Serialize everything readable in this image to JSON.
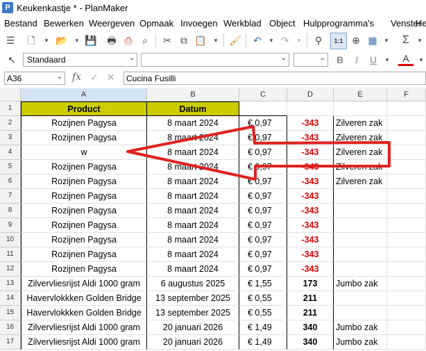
{
  "window": {
    "title": "Keukenkastje * - PlanMaker",
    "app_icon_letter": "P"
  },
  "menu": [
    "Bestand",
    "Bewerken",
    "Weergeven",
    "Opmaak",
    "Invoegen",
    "Werkblad",
    "Object",
    "Hulpprogramma's",
    "Venster",
    "He"
  ],
  "toolbar": {
    "style_value": "Standaard",
    "font_value": "",
    "size_value": "",
    "bold": "B",
    "italic": "I",
    "underline": "U",
    "font_color": "A"
  },
  "formula_bar": {
    "cell_ref": "A36",
    "fx_label": "fx",
    "content": "Cucina Fusilli"
  },
  "columns": [
    "A",
    "B",
    "C",
    "D",
    "E",
    "F"
  ],
  "header_row": {
    "row": "1",
    "product": "Product",
    "datum": "Datum"
  },
  "rows": [
    {
      "row": "2",
      "a": "Rozijnen Pagysa",
      "b": "8 maart 2024",
      "c": "€ 0,97",
      "d": "-343",
      "e": "Zilveren zak",
      "neg": true
    },
    {
      "row": "3",
      "a": "Rozijnen Pagysa",
      "b": "8 maart 2024",
      "c": "€ 0,97",
      "d": "-343",
      "e": "Zilveren zak",
      "neg": true
    },
    {
      "row": "4",
      "a": "w",
      "b": "8 maart 2024",
      "c": "€ 0,97",
      "d": "-343",
      "e": "Zilveren zak",
      "neg": true
    },
    {
      "row": "5",
      "a": "Rozijnen Pagysa",
      "b": "8 maart 2024",
      "c": "€ 0,97",
      "d": "-343",
      "e": "Zilveren zak",
      "neg": true
    },
    {
      "row": "6",
      "a": "Rozijnen Pagysa",
      "b": "8 maart 2024",
      "c": "€ 0,97",
      "d": "-343",
      "e": "Zilveren zak",
      "neg": true
    },
    {
      "row": "7",
      "a": "Rozijnen Pagysa",
      "b": "8 maart 2024",
      "c": "€ 0,97",
      "d": "-343",
      "e": "",
      "neg": true
    },
    {
      "row": "8",
      "a": "Rozijnen Pagysa",
      "b": "8 maart 2024",
      "c": "€ 0,97",
      "d": "-343",
      "e": "",
      "neg": true
    },
    {
      "row": "9",
      "a": "Rozijnen Pagysa",
      "b": "8 maart 2024",
      "c": "€ 0,97",
      "d": "-343",
      "e": "",
      "neg": true
    },
    {
      "row": "10",
      "a": "Rozijnen Pagysa",
      "b": "8 maart 2024",
      "c": "€ 0,97",
      "d": "-343",
      "e": "",
      "neg": true
    },
    {
      "row": "11",
      "a": "Rozijnen Pagysa",
      "b": "8 maart 2024",
      "c": "€ 0,97",
      "d": "-343",
      "e": "",
      "neg": true
    },
    {
      "row": "12",
      "a": "Rozijnen Pagysa",
      "b": "8 maart 2024",
      "c": "€ 0,97",
      "d": "-343",
      "e": "",
      "neg": true
    },
    {
      "row": "13",
      "a": "Zilvervliesrijst Aldi 1000 gram",
      "b": "6 augustus 2025",
      "c": "€ 1,55",
      "d": "173",
      "e": "Jumbo zak",
      "neg": false
    },
    {
      "row": "14",
      "a": "Havervlokkken Golden Bridge",
      "b": "13 september 2025",
      "c": "€ 0,55",
      "d": "211",
      "e": "",
      "neg": false
    },
    {
      "row": "15",
      "a": "Havervlokkken Golden Bridge",
      "b": "13 september 2025",
      "c": "€ 0,55",
      "d": "211",
      "e": "",
      "neg": false
    },
    {
      "row": "16",
      "a": "Zilvervliesrijst Aldi 1000 gram",
      "b": "20 januari 2026",
      "c": "€ 1,49",
      "d": "340",
      "e": "Jumbo zak",
      "neg": false
    },
    {
      "row": "17",
      "a": "Zilvervliesrijst Aldi 1000 gram",
      "b": "20 januari 2026",
      "c": "€ 1,49",
      "d": "340",
      "e": "Jumbo zak",
      "neg": false
    }
  ],
  "colors": {
    "header_fill": "#cccc00",
    "negative": "#dd0000",
    "annotation": "#e02020"
  }
}
